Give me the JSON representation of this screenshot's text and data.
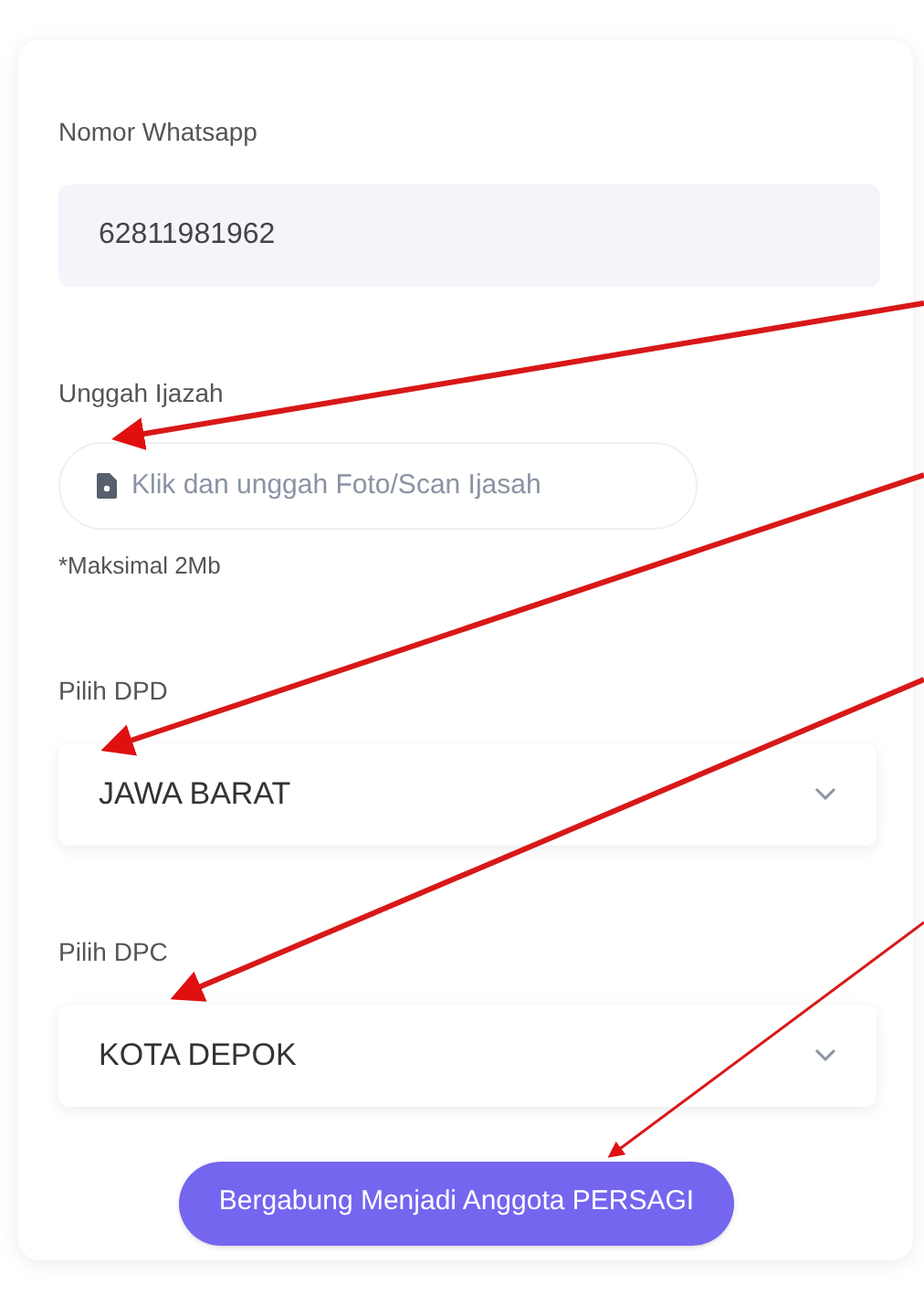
{
  "form": {
    "fields": [
      {
        "kind": "text",
        "label": "Nomor Whatsapp",
        "value": "62811981962"
      },
      {
        "kind": "file",
        "label": "Unggah Ijazah",
        "placeholder": "Klik dan unggah Foto/Scan Ijasah",
        "note": "*Maksimal 2Mb"
      },
      {
        "kind": "select",
        "label": "Pilih DPD",
        "value": "JAWA BARAT"
      },
      {
        "kind": "select",
        "label": "Pilih DPC",
        "value": "KOTA DEPOK"
      }
    ],
    "submit_button": "Bergabung Menjadi Anggota PERSAGI"
  }
}
